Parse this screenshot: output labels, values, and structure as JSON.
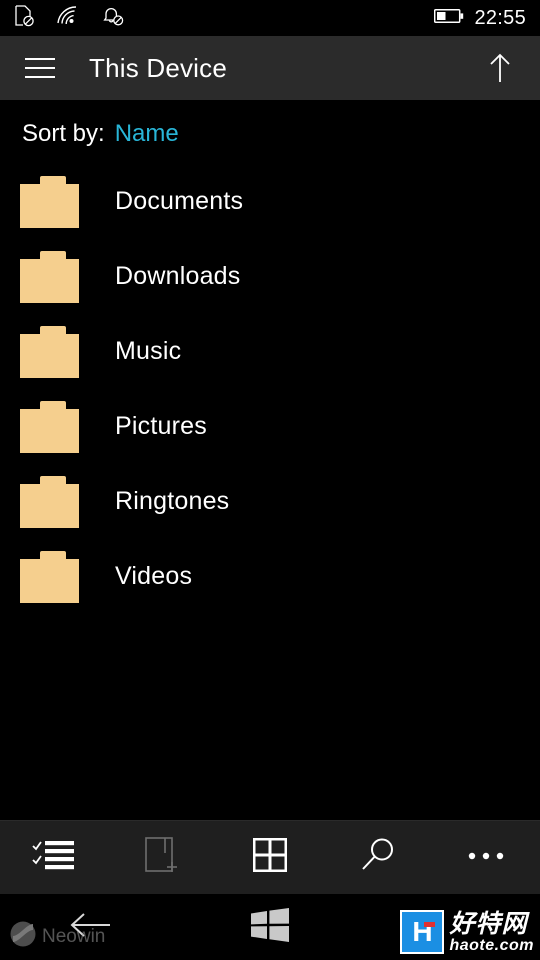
{
  "status_bar": {
    "icons": [
      {
        "name": "no-sim-icon",
        "label": "No SIM"
      },
      {
        "name": "wifi-icon",
        "label": "Wi-Fi"
      },
      {
        "name": "notifications-off-icon",
        "label": "Notifications off"
      }
    ],
    "battery": {
      "name": "battery-icon",
      "level_percent": 40
    },
    "time": "22:55"
  },
  "header": {
    "menu_icon": "hamburger-menu-icon",
    "title": "This Device",
    "up_icon": "arrow-up-icon"
  },
  "sort": {
    "label": "Sort by:",
    "value": "Name",
    "accent_color": "#29b6d8"
  },
  "folders": [
    {
      "name": "Documents",
      "icon": "folder-icon"
    },
    {
      "name": "Downloads",
      "icon": "folder-icon"
    },
    {
      "name": "Music",
      "icon": "folder-icon"
    },
    {
      "name": "Pictures",
      "icon": "folder-icon"
    },
    {
      "name": "Ringtones",
      "icon": "folder-icon"
    },
    {
      "name": "Videos",
      "icon": "folder-icon"
    }
  ],
  "command_bar": {
    "buttons": [
      {
        "name": "select-icon",
        "label": "Select",
        "enabled": true
      },
      {
        "name": "new-folder-icon",
        "label": "New folder",
        "enabled": false
      },
      {
        "name": "grid-view-icon",
        "label": "Grid view",
        "enabled": true
      },
      {
        "name": "search-icon",
        "label": "Search",
        "enabled": true
      },
      {
        "name": "more-options-icon",
        "label": "More",
        "enabled": true
      }
    ]
  },
  "nav_bar": {
    "back_icon": "back-arrow-icon",
    "home_icon": "windows-logo-icon"
  },
  "watermarks": {
    "neowin": {
      "text": "Neowin",
      "icon": "neowin-logo-icon"
    },
    "haote": {
      "logo_letter": "H",
      "chinese": "好特网",
      "url": "haote.com",
      "brand_color": "#1b8fe3"
    }
  },
  "theme": {
    "background": "#000000",
    "header_background": "#2b2b2b",
    "command_bar_background": "#1f1f1f",
    "folder_color": "#f5cf8e",
    "text_color": "#ffffff"
  }
}
